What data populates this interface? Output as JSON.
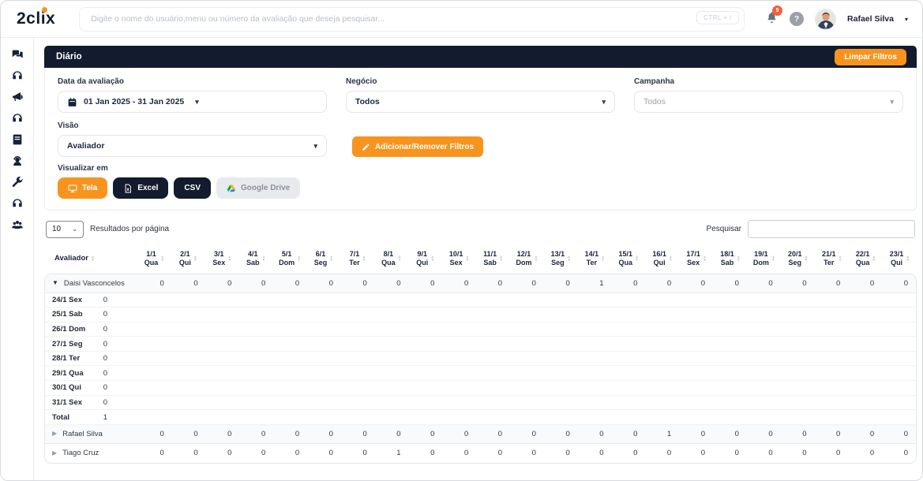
{
  "colors": {
    "accent": "#f7941e",
    "dark_navy": "#131c2e",
    "notification_badge": "#f2613e"
  },
  "header": {
    "logo": "2clix",
    "search_placeholder": "Digite o nome do usuário,menu ou número da avaliação que deseja pesquisar...",
    "shortcut_badge": "CTRL + /",
    "notification_count": "5",
    "help_glyph": "?",
    "user_name": "Rafael Silva"
  },
  "sidebar": {
    "icons": [
      "chat-bubbles",
      "headset",
      "megaphone",
      "headset",
      "journal",
      "support-agent",
      "wrench",
      "headset",
      "users-group"
    ]
  },
  "page": {
    "title": "Diário",
    "clear_filters_label": "Limpar Filtros"
  },
  "filters": {
    "date": {
      "label": "Data da avaliação",
      "value": "01 Jan 2025 - 31 Jan 2025"
    },
    "business": {
      "label": "Negócio",
      "value": "Todos"
    },
    "campaign": {
      "label": "Campanha",
      "value": "Todos"
    },
    "view": {
      "label": "Visão",
      "value": "Avaliador"
    },
    "add_remove_label": "Adicionar/Remover Filtros",
    "visualize_label": "Visualizar em",
    "export": [
      {
        "label": "Tela"
      },
      {
        "label": "Excel"
      },
      {
        "label": "CSV"
      },
      {
        "label": "Google Drive"
      }
    ]
  },
  "table": {
    "page_size": "10",
    "page_size_label": "Resultados por página",
    "search_label": "Pesquisar",
    "search_value": "",
    "first_column": "Avaliador",
    "columns": [
      {
        "day": "1/1",
        "weekday": "Qua"
      },
      {
        "day": "2/1",
        "weekday": "Qui"
      },
      {
        "day": "3/1",
        "weekday": "Sex"
      },
      {
        "day": "4/1",
        "weekday": "Sab"
      },
      {
        "day": "5/1",
        "weekday": "Dom"
      },
      {
        "day": "6/1",
        "weekday": "Seg"
      },
      {
        "day": "7/1",
        "weekday": "Ter"
      },
      {
        "day": "8/1",
        "weekday": "Qua"
      },
      {
        "day": "9/1",
        "weekday": "Qui"
      },
      {
        "day": "10/1",
        "weekday": "Sex"
      },
      {
        "day": "11/1",
        "weekday": "Sab"
      },
      {
        "day": "12/1",
        "weekday": "Dom"
      },
      {
        "day": "13/1",
        "weekday": "Seg"
      },
      {
        "day": "14/1",
        "weekday": "Ter"
      },
      {
        "day": "15/1",
        "weekday": "Qua"
      },
      {
        "day": "16/1",
        "weekday": "Qui"
      },
      {
        "day": "17/1",
        "weekday": "Sex"
      },
      {
        "day": "18/1",
        "weekday": "Sab"
      },
      {
        "day": "19/1",
        "weekday": "Dom"
      },
      {
        "day": "20/1",
        "weekday": "Seg"
      },
      {
        "day": "21/1",
        "weekday": "Ter"
      },
      {
        "day": "22/1",
        "weekday": "Qua"
      },
      {
        "day": "23/1",
        "weekday": "Qui"
      }
    ],
    "rows": [
      {
        "name": "Daisi Vasconcelos",
        "expanded": true,
        "shaded": true,
        "values": [
          "0",
          "0",
          "0",
          "0",
          "0",
          "0",
          "0",
          "0",
          "0",
          "0",
          "0",
          "0",
          "0",
          "1",
          "0",
          "0",
          "0",
          "0",
          "0",
          "0",
          "0",
          "0",
          "0"
        ]
      },
      {
        "name": "Rafael Silva",
        "expanded": false,
        "shaded": true,
        "values": [
          "0",
          "0",
          "0",
          "0",
          "0",
          "0",
          "0",
          "0",
          "0",
          "0",
          "0",
          "0",
          "0",
          "0",
          "0",
          "1",
          "0",
          "0",
          "0",
          "0",
          "0",
          "0",
          "0"
        ]
      },
      {
        "name": "Tiago Cruz",
        "expanded": false,
        "shaded": false,
        "values": [
          "0",
          "0",
          "0",
          "0",
          "0",
          "0",
          "0",
          "1",
          "0",
          "0",
          "0",
          "0",
          "0",
          "0",
          "0",
          "0",
          "0",
          "0",
          "0",
          "0",
          "0",
          "0",
          "0"
        ]
      }
    ],
    "expanded_child_rows": [
      {
        "label": "24/1 Sex",
        "value": "0"
      },
      {
        "label": "25/1 Sab",
        "value": "0"
      },
      {
        "label": "26/1 Dom",
        "value": "0"
      },
      {
        "label": "27/1 Seg",
        "value": "0"
      },
      {
        "label": "28/1 Ter",
        "value": "0"
      },
      {
        "label": "29/1 Qua",
        "value": "0"
      },
      {
        "label": "30/1 Qui",
        "value": "0"
      },
      {
        "label": "31/1 Sex",
        "value": "0"
      },
      {
        "label": "Total",
        "value": "1"
      }
    ]
  }
}
